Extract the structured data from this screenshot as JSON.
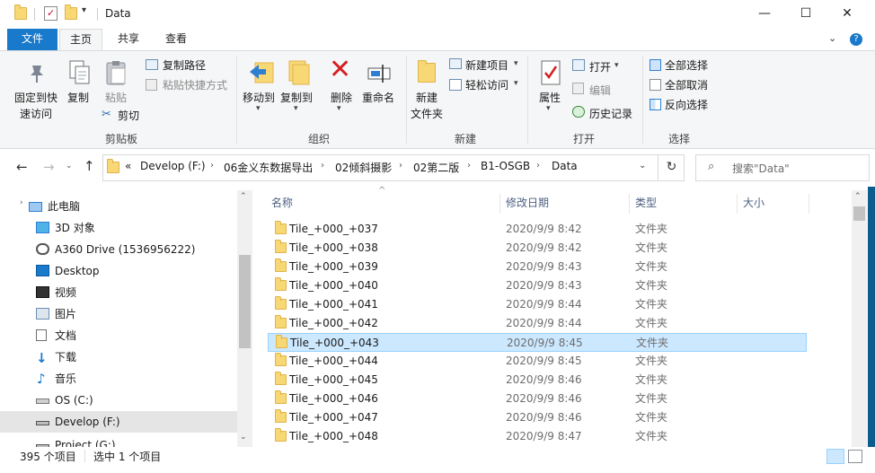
{
  "window": {
    "title": "Data",
    "controls": {
      "minimize": "—",
      "maximize": "☐",
      "close": "✕"
    }
  },
  "ribbon_tabs": [
    {
      "label": "文件",
      "active": false
    },
    {
      "label": "主页",
      "active": true
    },
    {
      "label": "共享",
      "active": false
    },
    {
      "label": "查看",
      "active": false
    }
  ],
  "ribbon": {
    "clipboard": {
      "group_label": "剪贴板",
      "pin_label_line1": "固定到快",
      "pin_label_line2": "速访问",
      "copy_label": "复制",
      "paste_label": "粘贴",
      "copy_path_label": "复制路径",
      "paste_shortcut_label": "粘贴快捷方式",
      "cut_label": "剪切"
    },
    "organize": {
      "group_label": "组织",
      "move_to_label": "移动到",
      "copy_to_label": "复制到",
      "delete_label": "删除",
      "rename_label": "重命名"
    },
    "new": {
      "group_label": "新建",
      "new_folder_line1": "新建",
      "new_folder_line2": "文件夹",
      "new_item_label": "新建项目",
      "easy_access_label": "轻松访问"
    },
    "open": {
      "group_label": "打开",
      "properties_label": "属性",
      "open_label": "打开",
      "edit_label": "编辑",
      "history_label": "历史记录"
    },
    "select": {
      "group_label": "选择",
      "select_all_label": "全部选择",
      "select_none_label": "全部取消",
      "invert_label": "反向选择"
    }
  },
  "address": {
    "prefix": "«",
    "crumbs": [
      "Develop (F:)",
      "06金义东数据导出",
      "02倾斜摄影",
      "02第二版",
      "B1-OSGB",
      "Data"
    ]
  },
  "search": {
    "placeholder": "搜索\"Data\""
  },
  "nav_pane": {
    "items": [
      {
        "label": "此电脑",
        "icon": "computer-icon",
        "level": 0,
        "selected": false
      },
      {
        "label": "3D 对象",
        "icon": "3d-objects-icon",
        "level": 1,
        "selected": false
      },
      {
        "label": "A360 Drive (1536956222)",
        "icon": "a360-drive-icon",
        "level": 1,
        "selected": false
      },
      {
        "label": "Desktop",
        "icon": "desktop-icon",
        "level": 1,
        "selected": false
      },
      {
        "label": "视频",
        "icon": "videos-icon",
        "level": 1,
        "selected": false
      },
      {
        "label": "图片",
        "icon": "pictures-icon",
        "level": 1,
        "selected": false
      },
      {
        "label": "文档",
        "icon": "documents-icon",
        "level": 1,
        "selected": false
      },
      {
        "label": "下载",
        "icon": "downloads-icon",
        "level": 1,
        "selected": false
      },
      {
        "label": "音乐",
        "icon": "music-icon",
        "level": 1,
        "selected": false
      },
      {
        "label": "OS (C:)",
        "icon": "os-drive-icon",
        "level": 1,
        "selected": false
      },
      {
        "label": "Develop (F:)",
        "icon": "drive-icon",
        "level": 1,
        "selected": true
      },
      {
        "label": "Project (G:)",
        "icon": "drive-icon",
        "level": 1,
        "selected": false
      }
    ]
  },
  "columns": {
    "name": "名称",
    "date": "修改日期",
    "type": "类型",
    "size": "大小"
  },
  "files": [
    {
      "name": "Tile_+000_+037",
      "date": "2020/9/9 8:42",
      "type": "文件夹",
      "selected": false
    },
    {
      "name": "Tile_+000_+038",
      "date": "2020/9/9 8:42",
      "type": "文件夹",
      "selected": false
    },
    {
      "name": "Tile_+000_+039",
      "date": "2020/9/9 8:43",
      "type": "文件夹",
      "selected": false
    },
    {
      "name": "Tile_+000_+040",
      "date": "2020/9/9 8:43",
      "type": "文件夹",
      "selected": false
    },
    {
      "name": "Tile_+000_+041",
      "date": "2020/9/9 8:44",
      "type": "文件夹",
      "selected": false
    },
    {
      "name": "Tile_+000_+042",
      "date": "2020/9/9 8:44",
      "type": "文件夹",
      "selected": false
    },
    {
      "name": "Tile_+000_+043",
      "date": "2020/9/9 8:45",
      "type": "文件夹",
      "selected": true
    },
    {
      "name": "Tile_+000_+044",
      "date": "2020/9/9 8:45",
      "type": "文件夹",
      "selected": false
    },
    {
      "name": "Tile_+000_+045",
      "date": "2020/9/9 8:46",
      "type": "文件夹",
      "selected": false
    },
    {
      "name": "Tile_+000_+046",
      "date": "2020/9/9 8:46",
      "type": "文件夹",
      "selected": false
    },
    {
      "name": "Tile_+000_+047",
      "date": "2020/9/9 8:46",
      "type": "文件夹",
      "selected": false
    },
    {
      "name": "Tile_+000_+048",
      "date": "2020/9/9 8:47",
      "type": "文件夹",
      "selected": false
    }
  ],
  "status": {
    "item_count": "395 个项目",
    "selected_count": "选中 1 个项目"
  },
  "colors": {
    "accent": "#1979ca",
    "selection": "#cce8ff",
    "folder": "#f8d775"
  }
}
